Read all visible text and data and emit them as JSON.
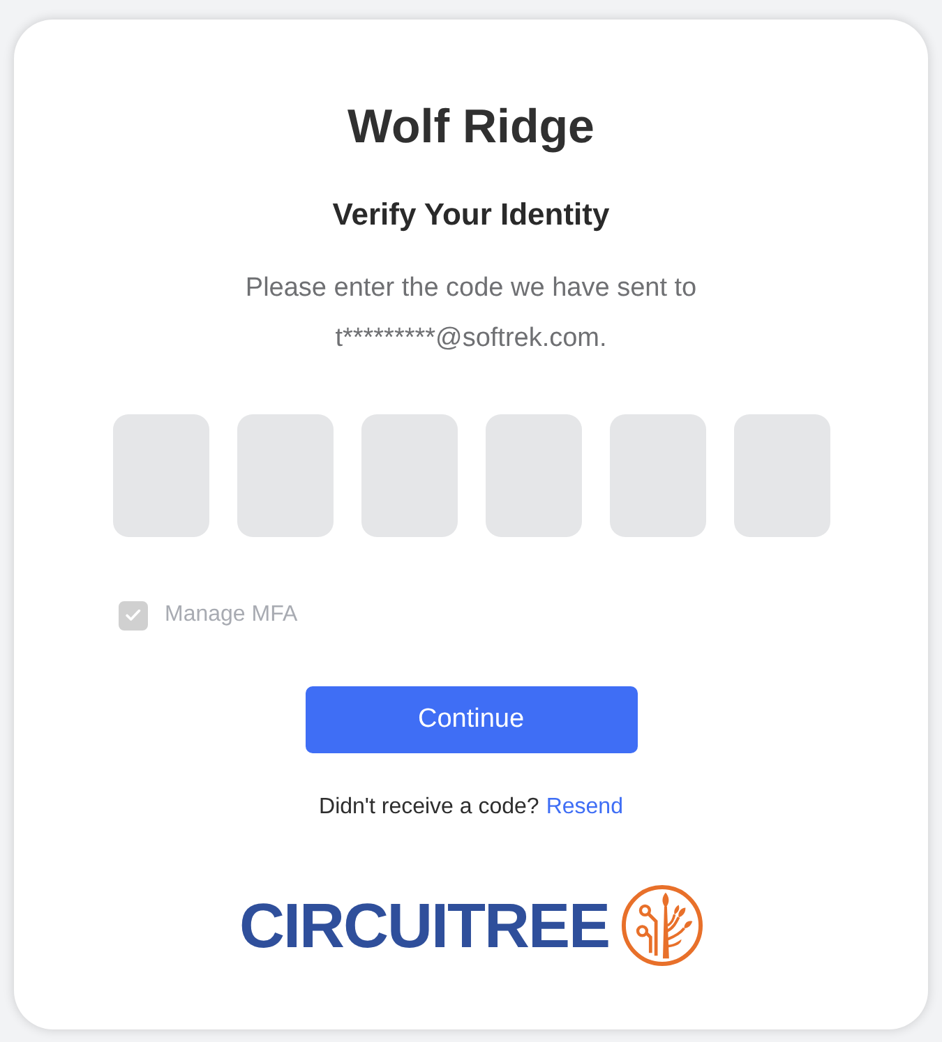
{
  "card": {
    "title": "Wolf Ridge",
    "subtitle": "Verify Your Identity",
    "description": "Please enter the code we have sent to t*********@softrek.com."
  },
  "code_fields": [
    {
      "kind": "digit"
    },
    {
      "kind": "digit"
    },
    {
      "kind": "digit"
    },
    {
      "kind": "digit"
    },
    {
      "kind": "digit"
    },
    {
      "kind": "digit"
    }
  ],
  "manage_mfa": {
    "label": "Manage MFA",
    "checked": true,
    "disabled": true
  },
  "continue_button": {
    "label": "Continue"
  },
  "resend": {
    "prompt": "Didn't receive a code?",
    "link": "Resend"
  },
  "logo": {
    "wordmark": "CIRCUITREE"
  }
}
